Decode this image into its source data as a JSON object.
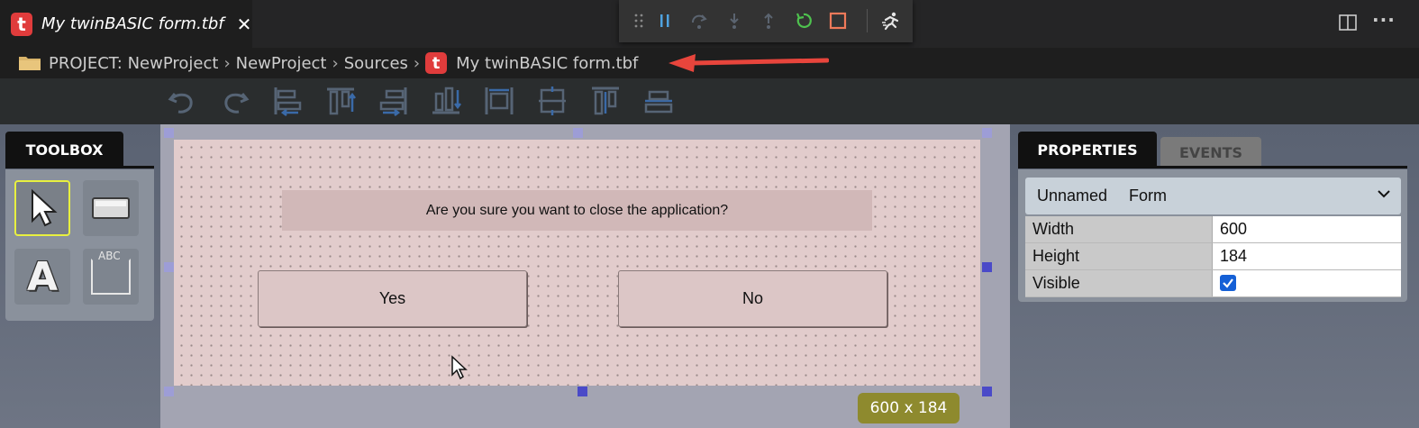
{
  "editor_tab": {
    "logo": "t",
    "title": "My twinBASIC form.tbf",
    "close": "✕"
  },
  "debug_toolbar": {
    "icons": [
      "gripper-icon",
      "pause-icon",
      "step-over-icon",
      "step-into-icon",
      "step-out-icon",
      "restart-icon",
      "stop-icon",
      "run-icon"
    ],
    "colors": {
      "pause": "#4fa3e0",
      "restart": "#4ec24e",
      "stop": "#f07a5a"
    }
  },
  "title_actions": {
    "more": "···"
  },
  "breadcrumb": {
    "items": [
      "PROJECT: NewProject",
      "NewProject",
      "Sources"
    ],
    "file_logo": "t",
    "file": "My twinBASIC form.tbf",
    "separator": "›",
    "arrow_color": "#e8453c"
  },
  "designer_toolbar": {
    "icons": [
      "undo-icon",
      "redo-icon",
      "align-left-icon",
      "align-top-icon",
      "align-right-icon",
      "align-bottom-icon",
      "distribute-horizontal-icon",
      "center-vertical-icon",
      "distribute-vertical-icon",
      "center-horizontal-icon"
    ]
  },
  "toolbox": {
    "tab": "TOOLBOX",
    "tools": [
      "pointer-tool",
      "command-button-tool",
      "label-tool",
      "frame-tool"
    ],
    "label_glyph": "A",
    "frame_caption": "ABC"
  },
  "form": {
    "label": "Are you sure you want to close the application?",
    "buttons": [
      "Yes",
      "No"
    ],
    "size_badge": "600 x 184",
    "background": "#e2cccc"
  },
  "properties": {
    "tabs": [
      "PROPERTIES",
      "EVENTS"
    ],
    "object_name": "Unnamed",
    "object_type": "Form",
    "rows": [
      {
        "name": "Width",
        "value": "600"
      },
      {
        "name": "Height",
        "value": "184"
      },
      {
        "name": "Visible",
        "checked": true
      }
    ]
  }
}
